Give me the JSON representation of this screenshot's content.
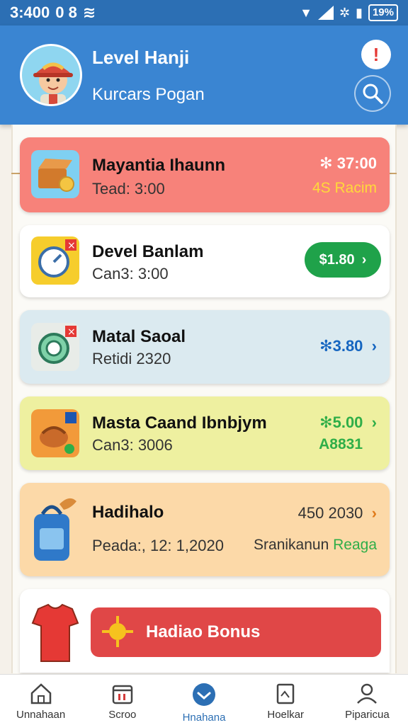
{
  "status_bar": {
    "time": "3:400",
    "left_icons": "0 8",
    "battery": "19%"
  },
  "header": {
    "title": "Level Hanji",
    "subtitle": "Kurcars Pogan"
  },
  "cards": [
    {
      "title": "Mayantia Ihaunn",
      "subtitle": "Tead: 3:00",
      "value": "✻ 37:00",
      "extra": "4S Racim",
      "bg": "#f7827a"
    },
    {
      "title": "Devel Banlam",
      "subtitle": "Can3: 3:00",
      "value": "$1.80"
    },
    {
      "title": "Matal Saoal",
      "subtitle": "Retidi 2320",
      "value": "✻3.80"
    },
    {
      "title": "Masta Caand Ibnbjym",
      "subtitle": "Can3: 3006",
      "value": "✻5.00",
      "extra": "A8831"
    },
    {
      "title": "Hadihalo",
      "subtitle": "Peada:, 12: 1,2020",
      "value": "450 2030",
      "extra_label": "Sranikanun",
      "extra": "Reaga"
    }
  ],
  "bonus": {
    "label": "Hadiao Bonus"
  },
  "nav": [
    {
      "label": "Unnahaan",
      "icon": "home-icon"
    },
    {
      "label": "Scroo",
      "icon": "calendar-icon"
    },
    {
      "label": "Hnahana",
      "icon": "chat-icon",
      "active": true
    },
    {
      "label": "Hoelkar",
      "icon": "document-icon"
    },
    {
      "label": "Piparicua",
      "icon": "profile-icon"
    }
  ],
  "colors": {
    "header": "#3a85d2",
    "status_bar": "#2c6fb4",
    "accent_green": "#1fa24a",
    "accent_blue": "#1565c0",
    "bonus_red": "#e04747"
  }
}
